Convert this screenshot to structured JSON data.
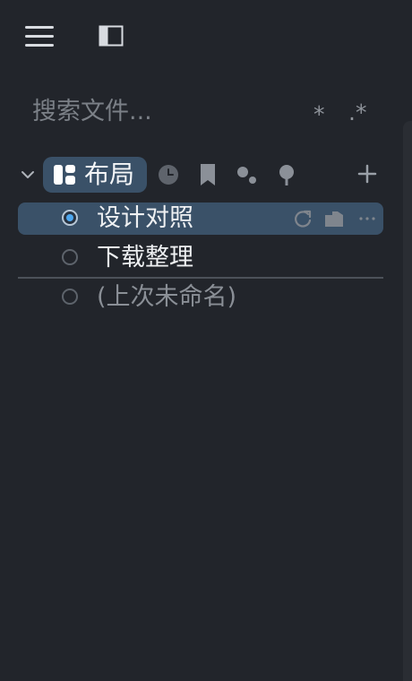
{
  "search": {
    "placeholder": "搜索文件...",
    "filter_star": "*",
    "filter_regex": ".*"
  },
  "group": {
    "label": "布局",
    "toolbar_icons": [
      "clock-icon",
      "bookmark-icon",
      "dots-icon",
      "pin-icon",
      "plus-icon"
    ]
  },
  "files": [
    {
      "name": "设计对照",
      "selected": true
    },
    {
      "name": "下载整理",
      "selected": false
    },
    {
      "name": "(上次未命名)",
      "selected": false
    }
  ],
  "colors": {
    "background": "#22252b",
    "selection": "#3a5168",
    "accent": "#4ea7ee",
    "muted_text": "#8a8f96"
  },
  "icons": {
    "top": [
      "menu-icon",
      "sidebar-toggle-icon"
    ],
    "row_actions": [
      "refresh-icon",
      "folder-icon",
      "more-icon"
    ]
  }
}
